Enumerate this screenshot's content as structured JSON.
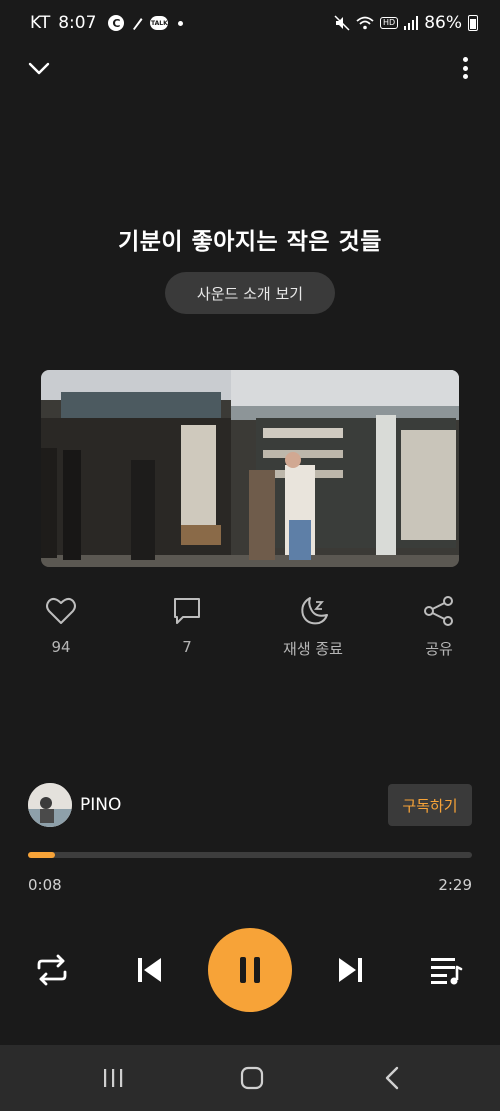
{
  "status_bar": {
    "carrier": "KT",
    "time": "8:07",
    "c_badge": "C",
    "talk_badge": "TALK",
    "hd_badge": "HD",
    "battery_text": "86%"
  },
  "track": {
    "title": "기분이 좋아지는 작은 것들",
    "intro_button_label": "사운드 소개 보기"
  },
  "actions": {
    "like_count": "94",
    "comment_count": "7",
    "sleep_label": "재생 종료",
    "share_label": "공유"
  },
  "channel": {
    "name": "PINO",
    "subscribe_label": "구독하기"
  },
  "playback": {
    "current_time": "0:08",
    "total_time": "2:29",
    "progress_fraction": 0.06,
    "state": "playing"
  },
  "icons": {
    "top_left": "chevron-down-icon",
    "top_right": "more-vert-icon",
    "repeat": "repeat-icon",
    "previous": "skip-previous-icon",
    "pause": "pause-icon",
    "next": "skip-next-icon",
    "playlist": "playlist-icon"
  },
  "colors": {
    "background": "#1a1a1a",
    "accent": "#f7a338",
    "nav_bar": "#2b2b2b"
  }
}
